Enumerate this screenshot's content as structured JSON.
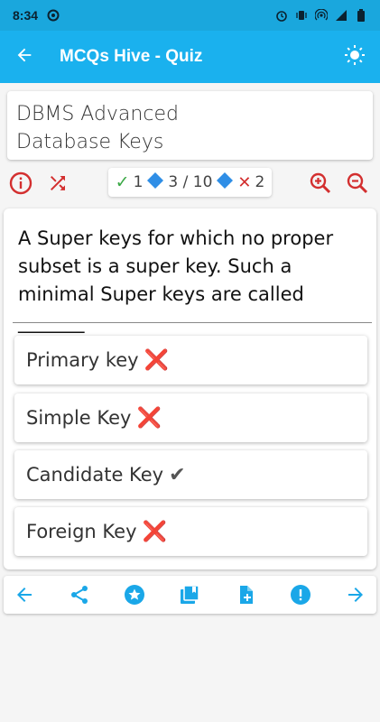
{
  "status_bar": {
    "time": "8:34"
  },
  "app_bar": {
    "title": "MCQs Hive - Quiz"
  },
  "topic": {
    "line1": "DBMS Advanced",
    "line2": "Database Keys"
  },
  "score": {
    "correct": "1",
    "position": "3 / 10",
    "wrong": "2"
  },
  "question": {
    "text": "A Super keys for which no proper subset is a super key. Such a minimal Super keys are called _______"
  },
  "options": [
    {
      "label": "Primary key",
      "mark": "❌",
      "state": "wrong"
    },
    {
      "label": "Simple Key",
      "mark": "❌",
      "state": "wrong"
    },
    {
      "label": "Candidate Key",
      "mark": "✔",
      "state": "correct"
    },
    {
      "label": "Foreign Key",
      "mark": "❌",
      "state": "wrong"
    }
  ],
  "colors": {
    "primary": "#1ab1ee",
    "accent_red": "#d32f2f",
    "icon_blue": "#1aa7e8",
    "diamond_blue": "#2f8ee6",
    "check_green": "#3aa845"
  },
  "icons": {
    "toolbar": [
      "info-icon",
      "shuffle-icon",
      "zoom-in-icon",
      "zoom-out-icon"
    ],
    "bottom": [
      "arrow-back-icon",
      "share-icon",
      "star-icon",
      "library-icon",
      "note-add-icon",
      "alert-icon",
      "arrow-forward-icon"
    ]
  }
}
